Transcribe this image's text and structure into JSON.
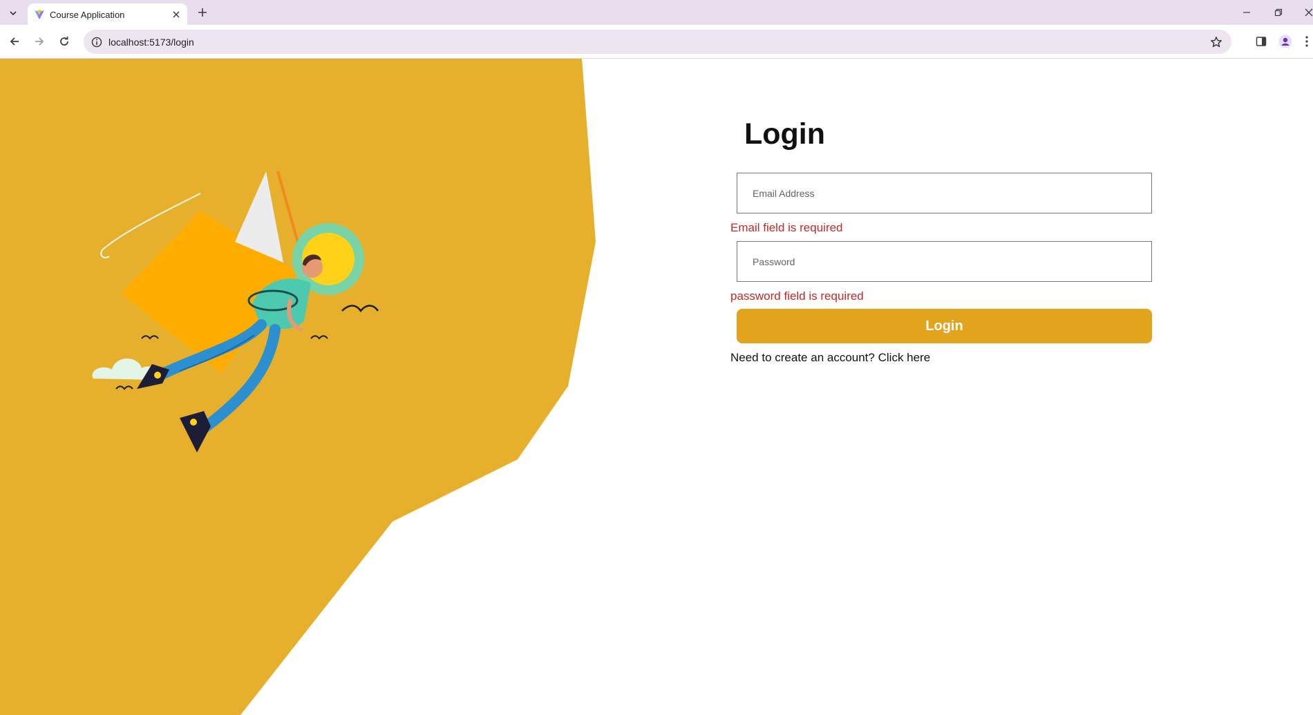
{
  "browser": {
    "tab_title": "Course Application",
    "url": "localhost:5173/login",
    "accent": "#e8deee"
  },
  "page": {
    "brand_color": "#e6b02d",
    "title": "Login",
    "email": {
      "placeholder": "Email Address",
      "value": "",
      "error": "Email field is required"
    },
    "password": {
      "placeholder": "Password",
      "value": "",
      "error": "password field is required"
    },
    "login_button": "Login",
    "signup_prompt": "Need to create an account?",
    "signup_link": "Click here",
    "illustration": "man-flying-with-kite-illustration"
  }
}
